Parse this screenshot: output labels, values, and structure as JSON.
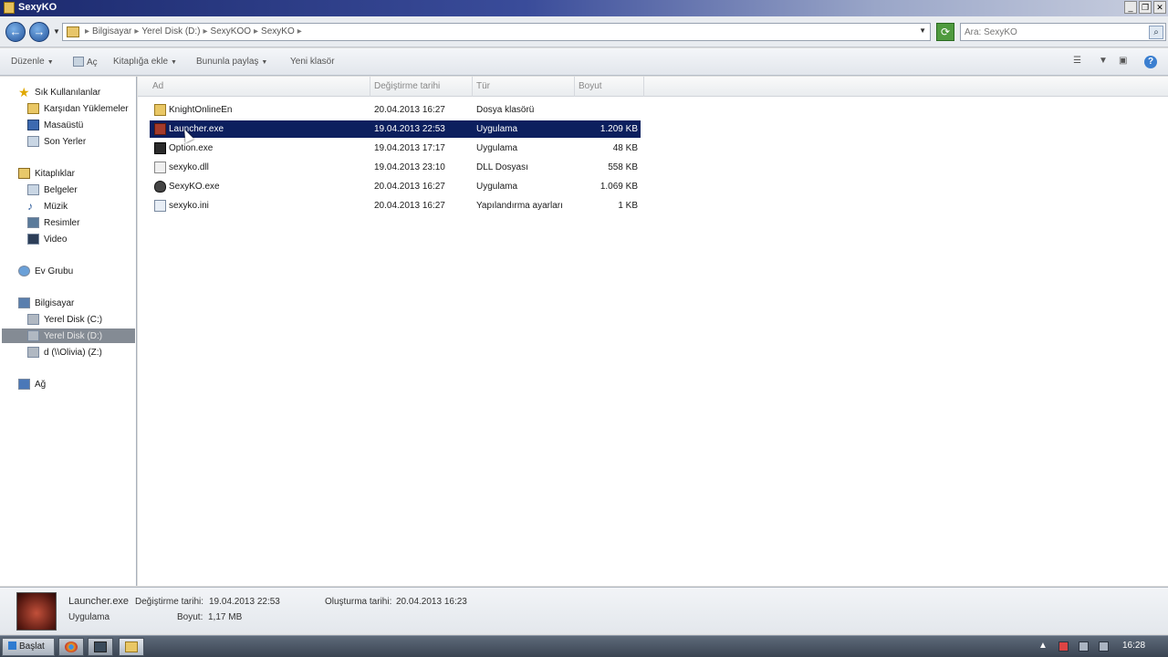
{
  "window": {
    "title": "SexyKO",
    "controls": [
      "_",
      "❐",
      "✕"
    ]
  },
  "address": {
    "breadcrumbs": [
      "Bilgisayar",
      "Yerel Disk (D:)",
      "SexyKOO",
      "SexyKO"
    ],
    "search_placeholder": "Ara: SexyKO"
  },
  "toolbar": {
    "organize": "Düzenle",
    "open": "Aç",
    "include_library": "Kitaplığa ekle",
    "share_with": "Bununla paylaş",
    "new_folder": "Yeni klasör"
  },
  "nav": {
    "favorites": "Sık Kullanılanlar",
    "downloads": "Karşıdan Yüklemeler",
    "desktop": "Masaüstü",
    "recent": "Son Yerler",
    "libraries": "Kitaplıklar",
    "documents": "Belgeler",
    "music": "Müzik",
    "pictures": "Resimler",
    "videos": "Video",
    "homegroup": "Ev Grubu",
    "computer": "Bilgisayar",
    "drive_c": "Yerel Disk (C:)",
    "drive_d": "Yerel Disk (D:)",
    "drive_z": "d (\\\\Olivia) (Z:)",
    "network": "Ağ"
  },
  "columns": {
    "name": "Ad",
    "modified": "Değiştirme tarihi",
    "type": "Tür",
    "size": "Boyut"
  },
  "files": [
    {
      "name": "KnightOnlineEn",
      "modified": "20.04.2013 16:27",
      "type": "Dosya klasörü",
      "size": "",
      "icon": "folder-icon"
    },
    {
      "name": "Launcher.exe",
      "modified": "19.04.2013 22:53",
      "type": "Uygulama",
      "size": "1.209 KB",
      "icon": "launcher-app-icon"
    },
    {
      "name": "Option.exe",
      "modified": "19.04.2013 17:17",
      "type": "Uygulama",
      "size": "48 KB",
      "icon": "option-app-icon"
    },
    {
      "name": "sexyko.dll",
      "modified": "19.04.2013 23:10",
      "type": "DLL Dosyası",
      "size": "558 KB",
      "icon": "dll-file-icon"
    },
    {
      "name": "SexyKO.exe",
      "modified": "20.04.2013 16:27",
      "type": "Uygulama",
      "size": "1.069 KB",
      "icon": "shield-app-icon"
    },
    {
      "name": "sexyko.ini",
      "modified": "20.04.2013 16:27",
      "type": "Yapılandırma ayarları",
      "size": "1 KB",
      "icon": "ini-file-icon"
    }
  ],
  "details": {
    "name": "Launcher.exe",
    "modified_label": "Değiştirme tarihi:",
    "modified": "19.04.2013 22:53",
    "created_label": "Oluşturma tarihi:",
    "created": "20.04.2013 16:23",
    "type": "Uygulama",
    "size_label": "Boyut:",
    "size": "1,17 MB"
  },
  "taskbar": {
    "start": "Başlat",
    "clock": "16:28"
  },
  "colors": {
    "selection": "#0c1f5e",
    "nav_selected": "#848b94"
  }
}
